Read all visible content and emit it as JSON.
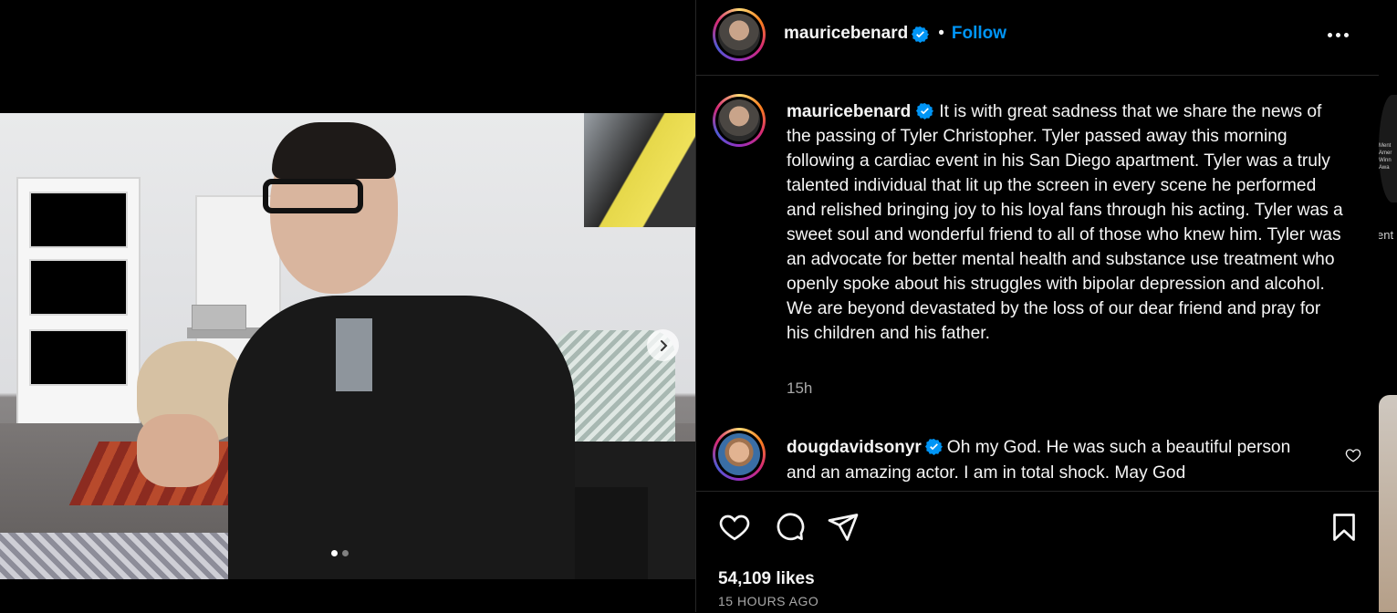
{
  "post": {
    "carousel": {
      "total_images": 2,
      "active_index": 0
    },
    "author": {
      "username": "mauricebenard",
      "verified": true
    },
    "header": {
      "separator": "•",
      "follow_label": "Follow"
    },
    "caption": {
      "username": "mauricebenard",
      "text": "It is with great sadness that we share the news of the passing of Tyler Christopher. Tyler passed away this morning following a cardiac event in his San Diego apartment. Tyler was a truly talented individual that lit up the screen in every scene he performed and relished bringing joy to his loyal fans through his acting. Tyler was a sweet soul and wonderful friend to all of those who knew him. Tyler was an advocate for better mental health and substance use treatment who openly spoke about his struggles with bipolar depression and alcohol. We are beyond devastated by the loss of our dear friend and pray for his children and his father.",
      "time": "15h"
    },
    "comments": [
      {
        "username": "dougdavidsonyr",
        "verified": true,
        "text": "Oh my God. He was such a beautiful person and an amazing actor. I am in total shock. May God"
      }
    ],
    "likes": "54,109 likes",
    "posted": "15 HOURS AGO"
  },
  "icons": {
    "like": "heart-icon",
    "comment": "comment-bubble-icon",
    "share": "paper-plane-icon",
    "save": "bookmark-icon",
    "more": "more-options-icon",
    "next": "chevron-right-icon",
    "verified": "verified-badge-icon"
  },
  "colors": {
    "background": "#000000",
    "follow": "#0095f6",
    "verified": "#0095f6",
    "muted": "#a8a8a8"
  },
  "side_peek": {
    "text_lines": [
      "Ment",
      "Amer",
      "Winn",
      "Awa"
    ],
    "label": "ent"
  }
}
